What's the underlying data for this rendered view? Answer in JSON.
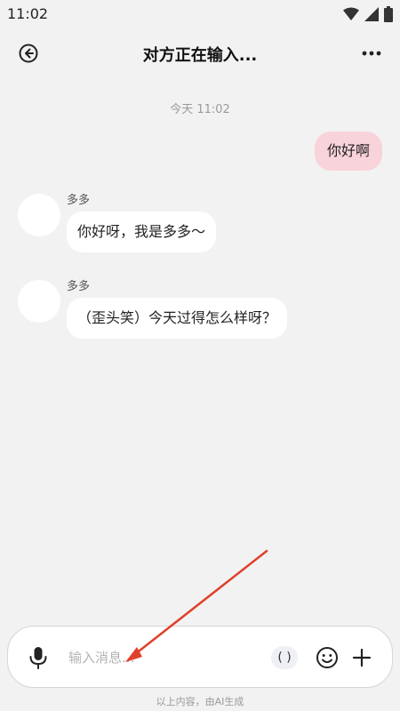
{
  "status_bar": {
    "time": "11:02"
  },
  "header": {
    "title": "对方正在输入..."
  },
  "chat": {
    "timestamp": "今天 11:02",
    "messages": [
      {
        "from": "me",
        "text": "你好啊"
      },
      {
        "from": "other",
        "sender": "多多",
        "text": "你好呀，我是多多～"
      },
      {
        "from": "other",
        "sender": "多多",
        "text": "（歪头笑）今天过得怎么样呀？"
      }
    ]
  },
  "input": {
    "placeholder": "输入消息...",
    "paren_button_label": "( )"
  },
  "footer": {
    "disclaimer": "以上内容，由AI生成"
  },
  "colors": {
    "background": "#f2f2f2",
    "outgoing_bubble": "#f9d3da",
    "incoming_bubble": "#ffffff",
    "annotation_arrow": "#e0402b"
  },
  "icons": [
    "back-arrow-icon",
    "more-dots-icon",
    "microphone-icon",
    "smiley-icon",
    "plus-icon",
    "wifi-icon",
    "signal-icon",
    "battery-icon"
  ]
}
